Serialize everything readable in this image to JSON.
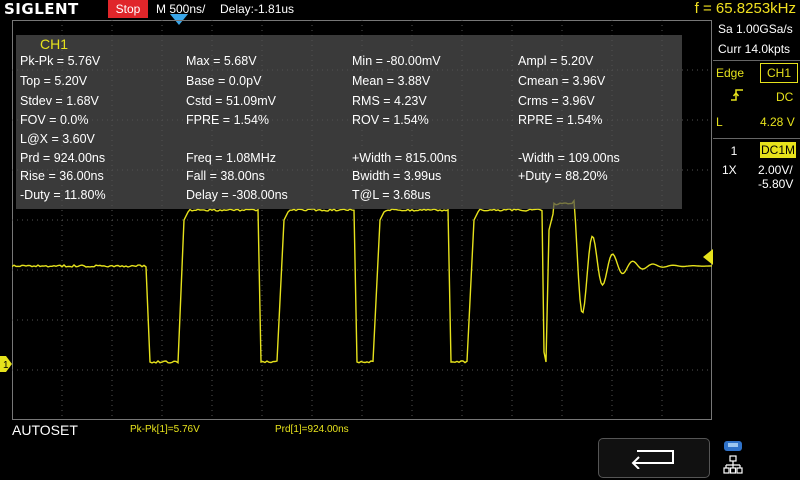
{
  "top_bar": {
    "logo": "SIGLENT",
    "run_state": "Stop",
    "timebase": "M 500ns/",
    "delay": "Delay:-1.81us",
    "frequency": "f = 65.8253kHz"
  },
  "measurements": {
    "title": "CH1",
    "rows": [
      [
        "Pk-Pk = 5.76V",
        "Max = 5.68V",
        "Min = -80.00mV",
        "Ampl = 5.20V"
      ],
      [
        "Top = 5.20V",
        "Base = 0.0pV",
        "Mean = 3.88V",
        "Cmean = 3.96V"
      ],
      [
        "Stdev = 1.68V",
        "Cstd = 51.09mV",
        "RMS = 4.23V",
        "Crms = 3.96V"
      ],
      [
        "FOV = 0.0%",
        "FPRE = 1.54%",
        "ROV = 1.54%",
        "RPRE = 1.54%"
      ],
      [
        "L@X = 3.60V",
        "",
        "",
        ""
      ],
      [
        "Prd = 924.00ns",
        "Freq = 1.08MHz",
        "+Width = 815.00ns",
        "-Width = 109.00ns"
      ],
      [
        "Rise = 36.00ns",
        "Fall = 38.00ns",
        "Bwidth = 3.99us",
        "+Duty = 88.20%"
      ],
      [
        "-Duty = 11.80%",
        "Delay = -308.00ns",
        "T@L = 3.68us",
        ""
      ]
    ]
  },
  "right_panel": {
    "sample_rate": "Sa 1.00GSa/s",
    "memory_depth": "Curr 14.0kpts",
    "trigger_type": "Edge",
    "trigger_source": "CH1",
    "trigger_coupling": "DC",
    "level_label": "L",
    "level_value": "4.28 V",
    "channel_number": "1",
    "channel_coupling": "DC1M",
    "probe": "1X",
    "scale": "2.00V/",
    "offset": "-5.80V"
  },
  "bottom": {
    "menu_title": "AUTOSET",
    "measure_1": "Pk-Pk[1]=5.76V",
    "measure_2": "Prd[1]=924.00ns"
  },
  "ch1_marker": "1",
  "colors": {
    "trace": "#e6e21c",
    "stop_badge": "#e0262a",
    "trigger_pos": "#3aa6e8",
    "grid": "#555555"
  }
}
